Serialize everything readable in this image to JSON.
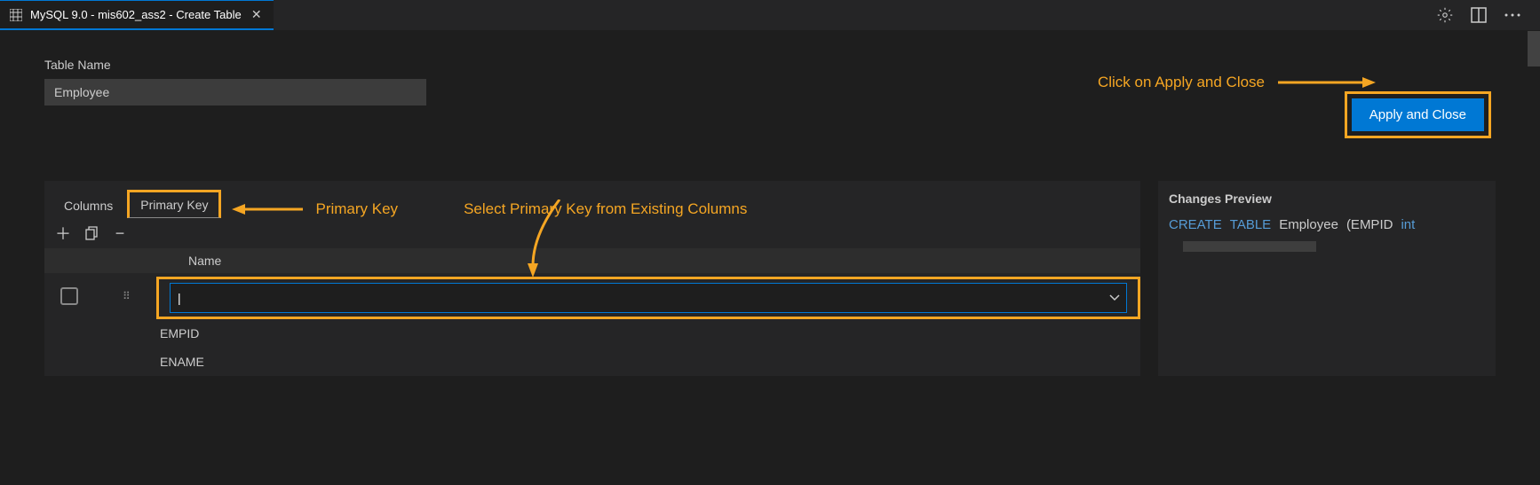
{
  "tab": {
    "title": "MySQL 9.0 - mis602_ass2 - Create Table"
  },
  "form": {
    "table_name_label": "Table Name",
    "table_name_value": "Employee"
  },
  "apply_button": {
    "label": "Apply and Close"
  },
  "annotations": {
    "apply": "Click on Apply and Close",
    "primary_key": "Primary Key",
    "select_pk": "Select Primary Key from Existing Columns"
  },
  "sub_tabs": {
    "columns": "Columns",
    "primary_key": "Primary Key"
  },
  "pk_table": {
    "header_name": "Name",
    "dropdown_value": ""
  },
  "dropdown_options": [
    "EMPID",
    "ENAME"
  ],
  "preview": {
    "title": "Changes Preview",
    "sql_kw1": "CREATE",
    "sql_kw2": "TABLE",
    "sql_name": "Employee",
    "sql_paren": "(EMPID",
    "sql_type": "int"
  }
}
